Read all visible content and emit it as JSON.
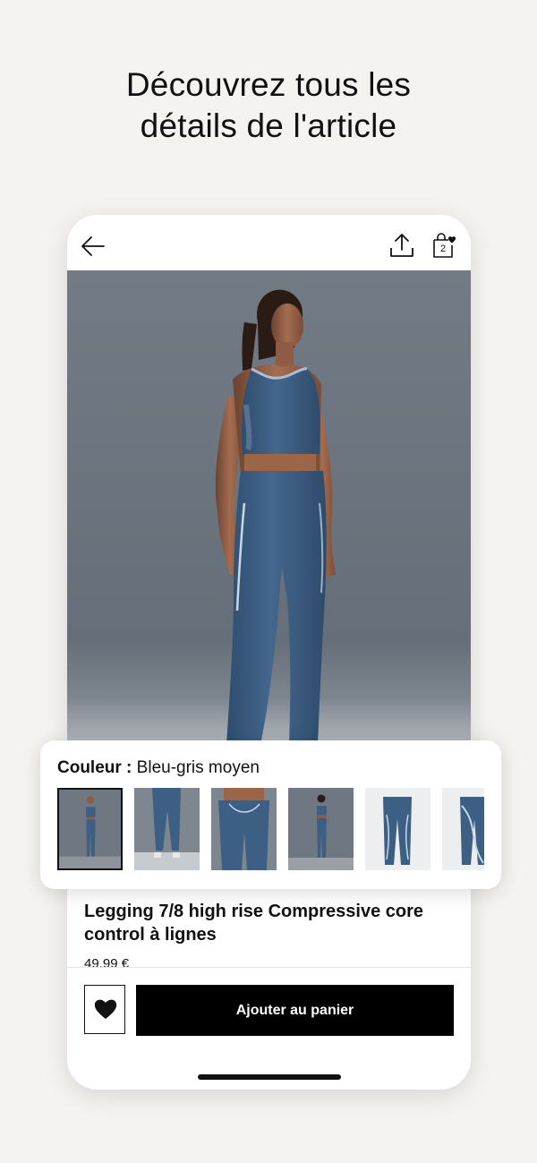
{
  "promo": {
    "headline_line1": "Découvrez tous les",
    "headline_line2": "détails de l'article"
  },
  "topbar": {
    "back_icon": "arrow-left-icon",
    "share_icon": "share-icon",
    "bag_icon": "shopping-bag-heart-icon",
    "bag_count": "2"
  },
  "product": {
    "title": "Legging 7/8 high rise Compressive core control à lignes",
    "price": "49,99 €"
  },
  "color_picker": {
    "label": "Couleur :",
    "selected_color": "Bleu-gris moyen",
    "swatches": [
      {
        "name": "model-front",
        "selected": true
      },
      {
        "name": "legs-front",
        "selected": false
      },
      {
        "name": "back-view",
        "selected": false
      },
      {
        "name": "model-back",
        "selected": false
      },
      {
        "name": "flat-front",
        "selected": false
      },
      {
        "name": "flat-detail",
        "selected": false
      }
    ]
  },
  "actions": {
    "add_to_cart_label": "Ajouter au panier",
    "favorite_icon": "heart-icon"
  },
  "colors": {
    "product_blue": "#3d5f84",
    "backdrop_gray": "#6b747e",
    "page_bg": "#f4f3f0"
  }
}
